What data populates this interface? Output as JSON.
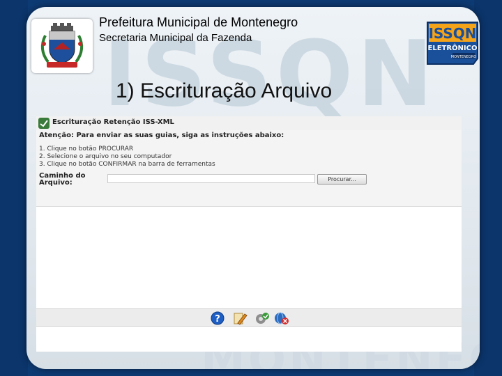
{
  "header": {
    "line1": "Prefeitura Municipal de Montenegro",
    "line2": "Secretaria Municipal da Fazenda"
  },
  "slide_title": "1) Escrituração Arquivo",
  "background_watermark": {
    "top": "ISSQN",
    "bottom": "MONTENEGRO"
  },
  "brand_logo": {
    "line1": "ISSQN",
    "line2": "ELETRÔNICO",
    "line3": "MONTENEGRO",
    "accent": "#f5a318",
    "blue": "#1a4f9a"
  },
  "panel": {
    "title": "Escrituração Retenção ISS-XML",
    "attention": "Atenção: Para enviar as suas guias, siga as instruções abaixo:",
    "steps": [
      "1. Clique no botão PROCURAR",
      "2. Selecione o arquivo no seu computador",
      "3. Clique no botão CONFIRMAR na barra de ferramentas"
    ],
    "path_label": "Caminho do Arquivo:",
    "file_value": "",
    "browse_label": "Procurar..."
  },
  "toolbar_icons": [
    "help-icon",
    "edit-icon",
    "confirm-icon",
    "close-icon"
  ]
}
